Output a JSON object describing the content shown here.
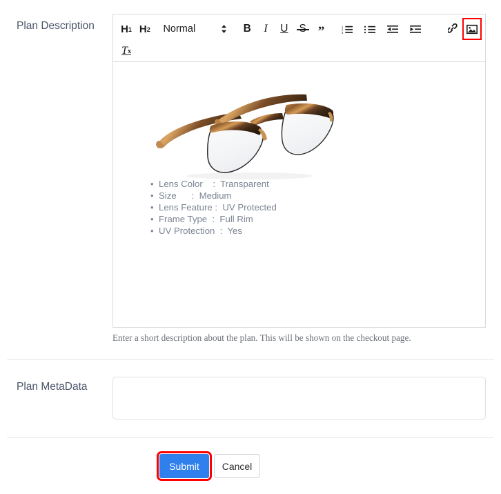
{
  "form": {
    "description_section": {
      "label": "Plan Description",
      "helper_text": "Enter a short description about the plan. This will be shown on the checkout page."
    },
    "metadata_section": {
      "label": "Plan MetaData",
      "value": "",
      "placeholder": ""
    }
  },
  "toolbar": {
    "h1_label": "H",
    "h1_sub": "1",
    "h2_label": "H",
    "h2_sub": "2",
    "format_select_value": "Normal",
    "bold_label": "B",
    "italic_label": "I",
    "underline_label": "U",
    "strike_label": "S",
    "quote_label": "”",
    "clearfmt_label": "T",
    "clearfmt_sub": "x",
    "icons": {
      "ordered_list": "ordered-list-icon",
      "bullet_list": "bullet-list-icon",
      "outdent": "outdent-icon",
      "indent": "indent-icon",
      "link": "link-icon",
      "image": "image-icon"
    },
    "active_tool": "image-icon",
    "highlight_color": "#ff0000"
  },
  "editor_content": {
    "image_alt": "tortoiseshell browline eyeglasses",
    "features": [
      "Lens Color    :  Transparent",
      "Size      :  Medium",
      "Lens Feature :  UV Protected",
      "Frame Type  :  Full Rim",
      "UV Protection  :  Yes"
    ]
  },
  "actions": {
    "submit_label": "Submit",
    "cancel_label": "Cancel",
    "submit_color": "#2f80ed",
    "highlight_color": "#ff0000"
  }
}
